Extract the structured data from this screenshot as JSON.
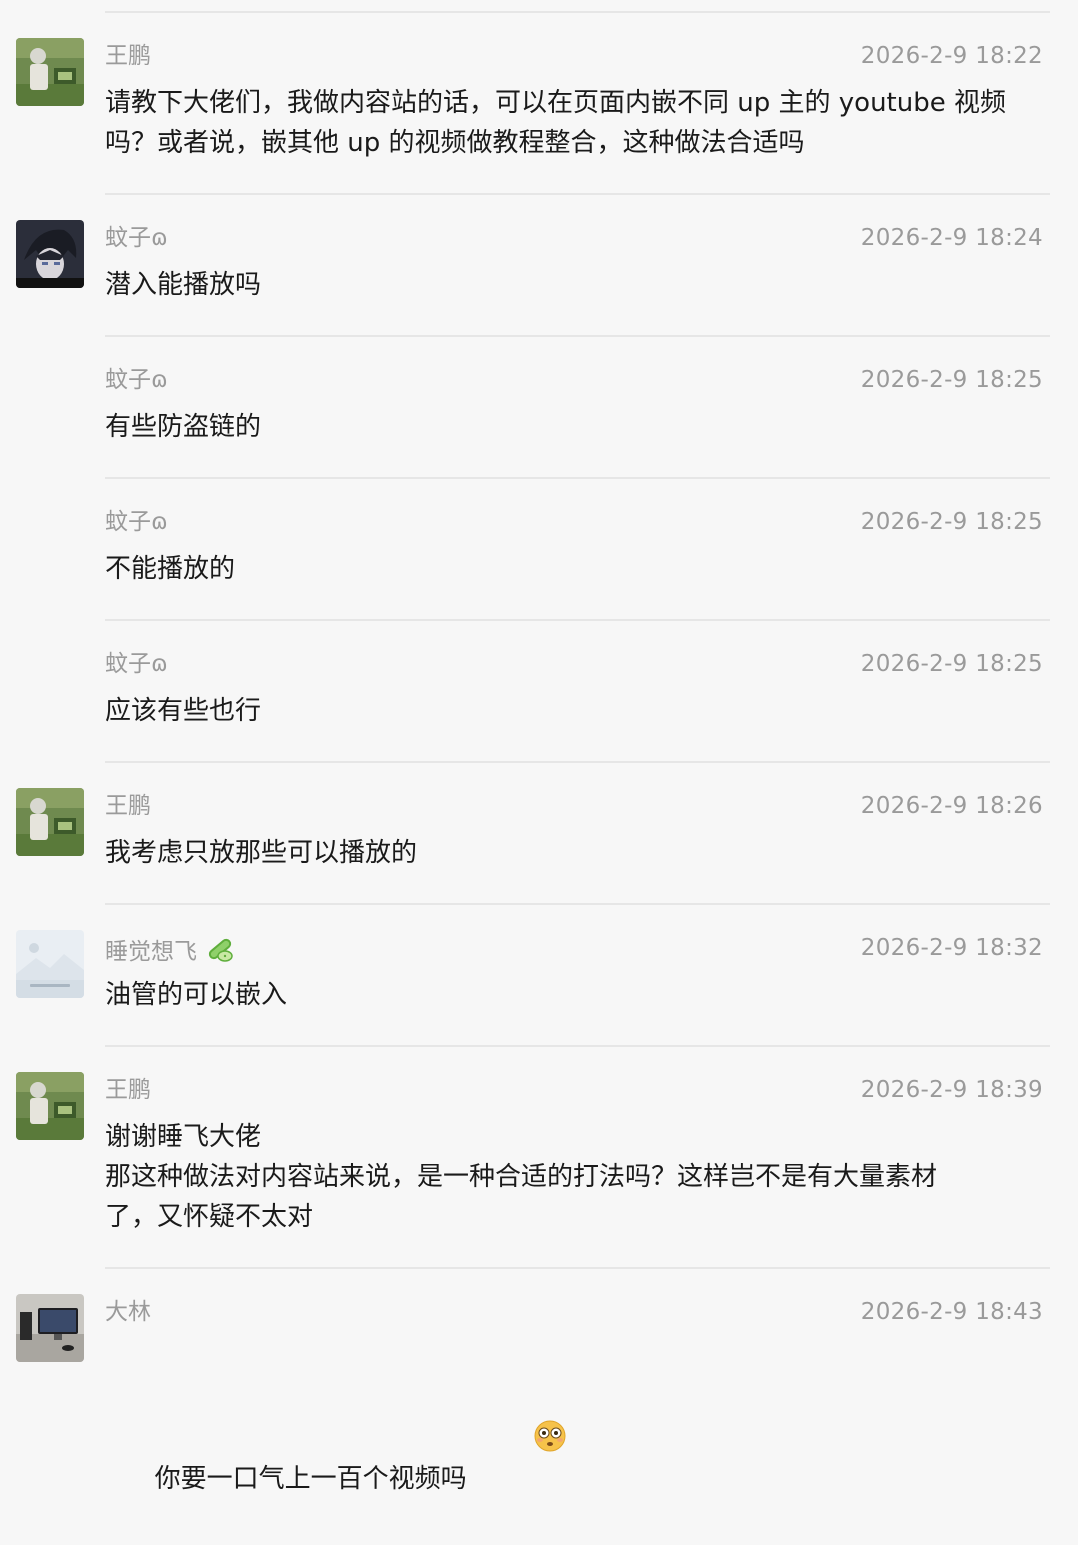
{
  "messages": [
    {
      "sender": "王鹏",
      "time": "2026-2-9 18:22",
      "avatar": "wangpeng-avatar",
      "text": "请教下大佬们，我做内容站的话，可以在页面内嵌不同 up 主的 youtube 视频\n吗？或者说，嵌其他 up 的视频做教程整合，这种做法合适吗"
    },
    {
      "sender": "蚊子ɷ",
      "time": "2026-2-9 18:24",
      "avatar": "wenzi-avatar",
      "text": "潜入能播放吗"
    },
    {
      "sender": "蚊子ɷ",
      "time": "2026-2-9 18:25",
      "avatar": "",
      "text": "有些防盗链的"
    },
    {
      "sender": "蚊子ɷ",
      "time": "2026-2-9 18:25",
      "avatar": "",
      "text": "不能播放的"
    },
    {
      "sender": "蚊子ɷ",
      "time": "2026-2-9 18:25",
      "avatar": "",
      "text": "应该有些也行"
    },
    {
      "sender": "王鹏",
      "time": "2026-2-9 18:26",
      "avatar": "wangpeng-avatar",
      "text": "我考虑只放那些可以播放的"
    },
    {
      "sender": "睡觉想飞",
      "time": "2026-2-9 18:32",
      "avatar": "shuijiaoxiangfei-avatar",
      "badge": "cucumber-emoji",
      "text": "油管的可以嵌入"
    },
    {
      "sender": "王鹏",
      "time": "2026-2-9 18:39",
      "avatar": "wangpeng-avatar",
      "text": "谢谢睡飞大佬\n那这种做法对内容站来说，是一种合适的打法吗？这样岂不是有大量素材\n了，又怀疑不太对"
    },
    {
      "sender": "大林",
      "time": "2026-2-9 18:43",
      "avatar": "dalin-avatar",
      "text": "你要一口气上一百个视频吗",
      "trailing_emoji": "flushed-face-emoji"
    }
  ]
}
